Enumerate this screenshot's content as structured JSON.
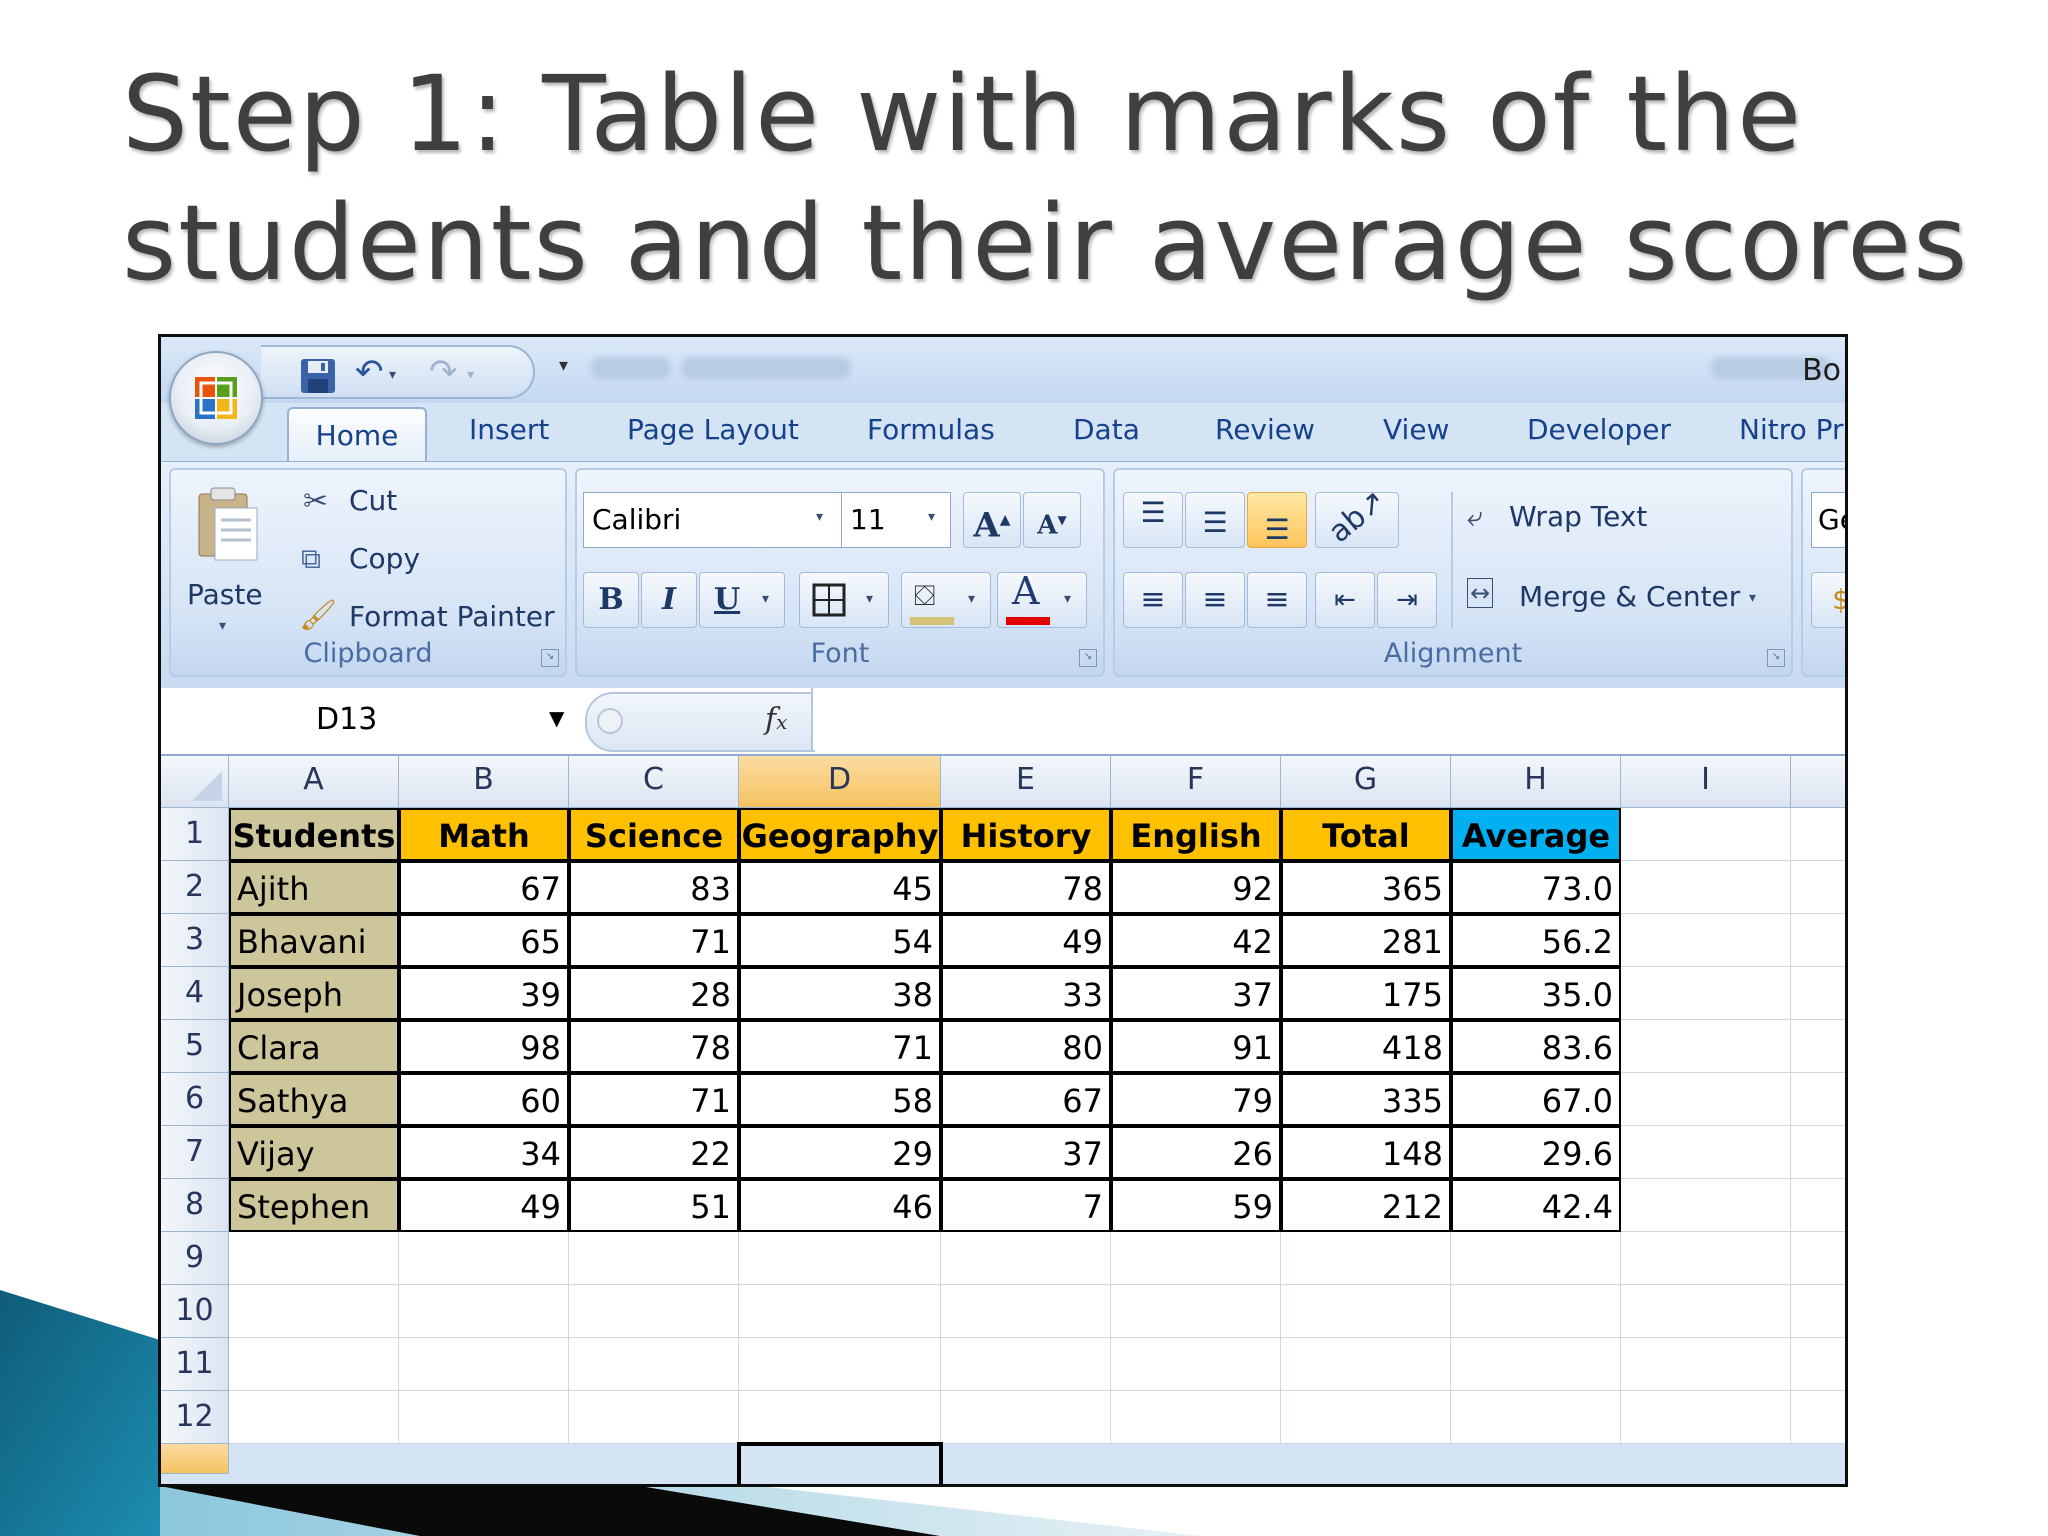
{
  "slide": {
    "title_line1": "Step 1: Table with marks of the",
    "title_line2": "students and their average scores"
  },
  "window": {
    "title_fragment": "Bo",
    "quick_access": [
      "save-icon",
      "undo-icon",
      "redo-icon"
    ]
  },
  "ribbon": {
    "tabs": [
      "Home",
      "Insert",
      "Page Layout",
      "Formulas",
      "Data",
      "Review",
      "View",
      "Developer",
      "Nitro Pr"
    ],
    "active_tab": "Home",
    "clipboard": {
      "label": "Clipboard",
      "paste": "Paste",
      "cut": "Cut",
      "copy": "Copy",
      "format_painter": "Format Painter"
    },
    "font": {
      "label": "Font",
      "family": "Calibri",
      "size": "11",
      "bold": "B",
      "italic": "I",
      "underline": "U",
      "font_color_letter": "A",
      "font_color": "#e00000",
      "fill_color": "#d6c37a"
    },
    "alignment": {
      "label": "Alignment",
      "wrap_text": "Wrap Text",
      "merge_center": "Merge & Center"
    },
    "number": {
      "format_fragment": "Ger"
    }
  },
  "formula_bar": {
    "name_box": "D13",
    "fx": "fx",
    "formula": ""
  },
  "sheet": {
    "columns": [
      "A",
      "B",
      "C",
      "D",
      "E",
      "F",
      "G",
      "H",
      "I"
    ],
    "selected_column": "D",
    "rows": [
      "1",
      "2",
      "3",
      "4",
      "5",
      "6",
      "7",
      "8",
      "9",
      "10",
      "11",
      "12"
    ],
    "headers": [
      "Students",
      "Math",
      "Science",
      "Geography",
      "History",
      "English",
      "Total",
      "Average"
    ],
    "header_colors": {
      "students": "#ccc69a",
      "subjects": "#ffc000",
      "average": "#00b0f0"
    },
    "data": [
      [
        "Ajith",
        "67",
        "83",
        "45",
        "78",
        "92",
        "365",
        "73.0"
      ],
      [
        "Bhavani",
        "65",
        "71",
        "54",
        "49",
        "42",
        "281",
        "56.2"
      ],
      [
        "Joseph",
        "39",
        "28",
        "38",
        "33",
        "37",
        "175",
        "35.0"
      ],
      [
        "Clara",
        "98",
        "78",
        "71",
        "80",
        "91",
        "418",
        "83.6"
      ],
      [
        "Sathya",
        "60",
        "71",
        "58",
        "67",
        "79",
        "335",
        "67.0"
      ],
      [
        "Vijay",
        "34",
        "22",
        "29",
        "37",
        "26",
        "148",
        "29.6"
      ],
      [
        "Stephen",
        "49",
        "51",
        "46",
        "7",
        "59",
        "212",
        "42.4"
      ]
    ]
  }
}
